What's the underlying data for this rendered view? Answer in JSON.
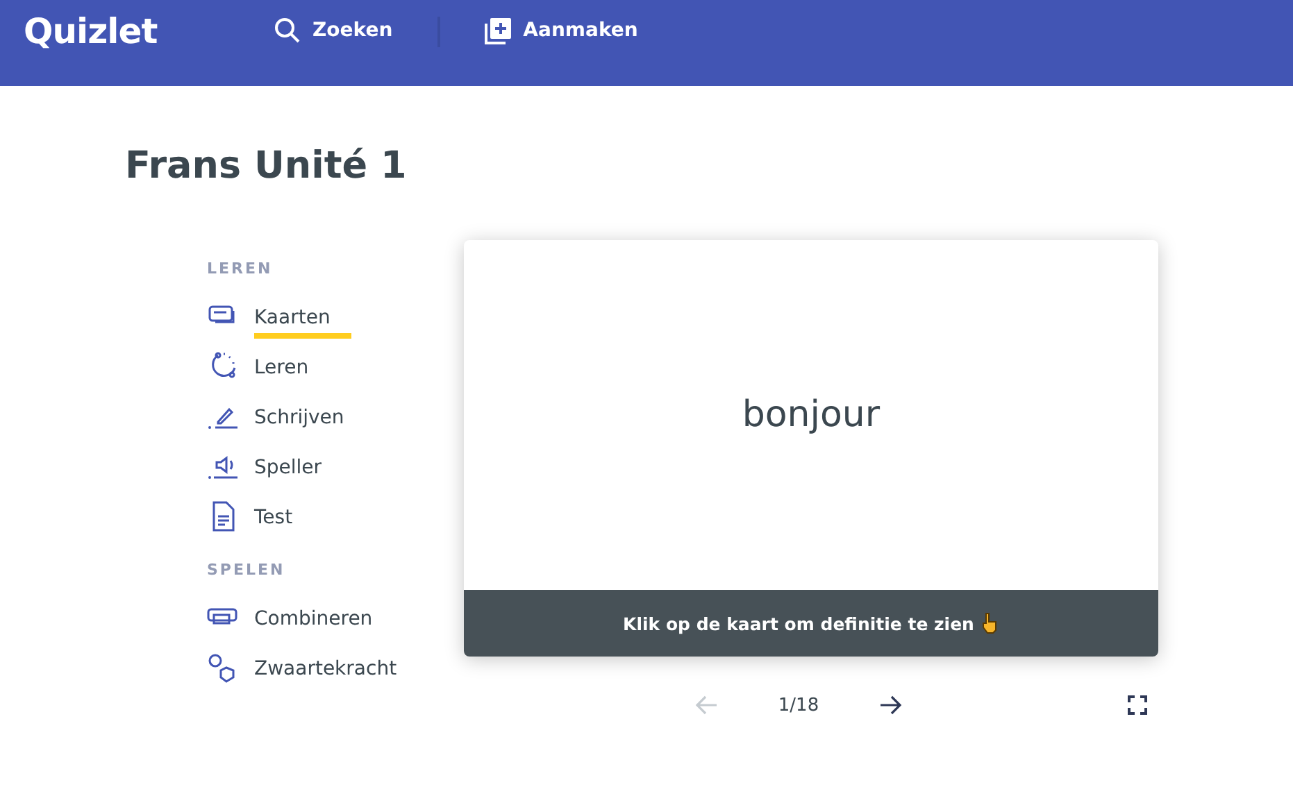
{
  "header": {
    "logo": "Quizlet",
    "nav": [
      {
        "kind": "search",
        "label": "Zoeken"
      },
      {
        "kind": "create",
        "label": "Aanmaken"
      }
    ]
  },
  "title": "Frans Unité 1",
  "sidebar": {
    "sections": [
      {
        "heading": "LEREN",
        "items": [
          {
            "kind": "cards",
            "label": "Kaarten",
            "selected": true
          },
          {
            "kind": "learn",
            "label": "Leren",
            "selected": false
          },
          {
            "kind": "write",
            "label": "Schrijven",
            "selected": false
          },
          {
            "kind": "spell",
            "label": "Speller",
            "selected": false
          },
          {
            "kind": "test",
            "label": "Test",
            "selected": false
          }
        ]
      },
      {
        "heading": "SPELEN",
        "items": [
          {
            "kind": "match",
            "label": "Combineren",
            "selected": false
          },
          {
            "kind": "gravity",
            "label": "Zwaartekracht",
            "selected": false
          }
        ]
      }
    ]
  },
  "card": {
    "term": "bonjour",
    "hint": "Klik op de kaart om definitie te zien"
  },
  "controls": {
    "prev_disabled": true,
    "counter": "1/18",
    "next_disabled": false
  }
}
